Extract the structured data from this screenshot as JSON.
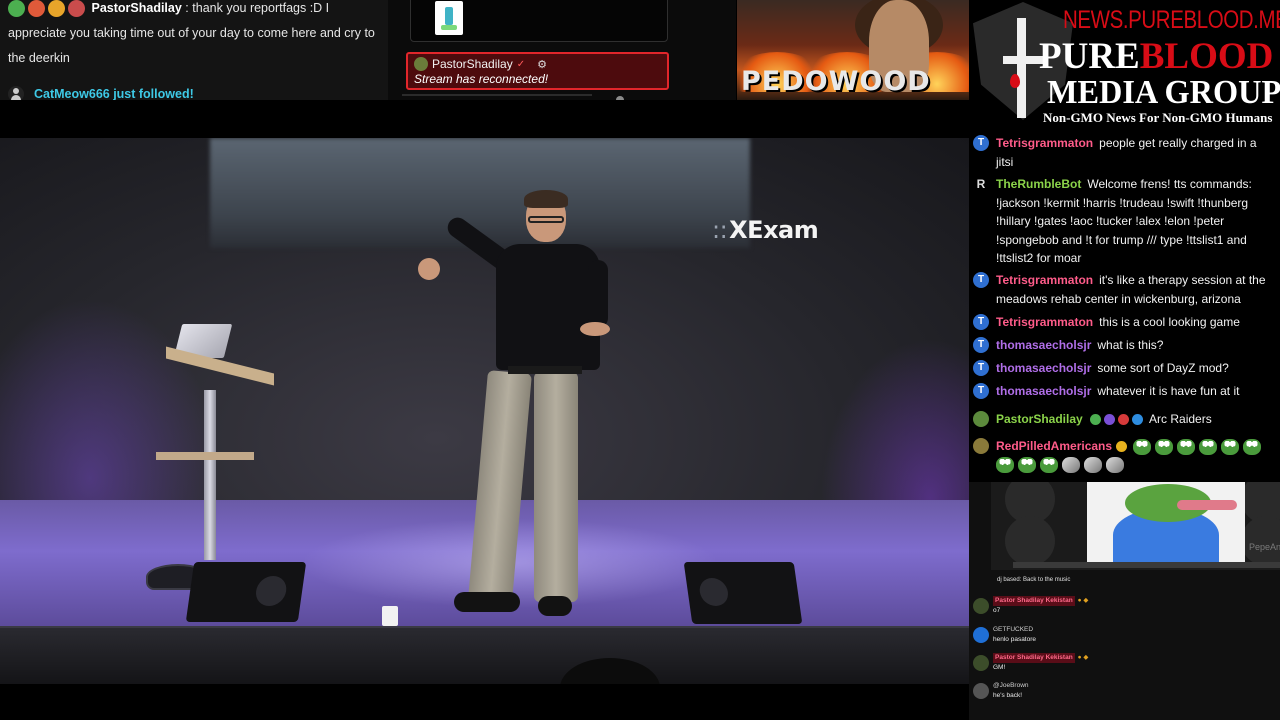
{
  "top_chat": {
    "message": {
      "username": "PastorShadilay",
      "separator": ":",
      "text": "thank you reportfags :D I appreciate you taking time out of your day to come here and cry to the deerkin",
      "badge_colors": [
        "#4caf50",
        "#e05a3a",
        "#e8a52a",
        "#c94c4c"
      ]
    },
    "follow_notice": "CatMeow666 just followed!"
  },
  "alerts": {
    "reconnect": {
      "username": "PastorShadilay",
      "verified_glyph": "✓",
      "settings_icon": "gear-icon",
      "message": "Stream has reconnected!"
    }
  },
  "top_thumbnail": {
    "text": "PEDOWOOD"
  },
  "logo": {
    "url": "NEWS.PUREBLOOD.MEDIA",
    "line1_white": "PURE",
    "line1_red": "BLOOD",
    "line2": "MEDIA GROUP",
    "tagline": "Non-GMO News For Non-GMO Humans",
    "brand_red": "#d80c16"
  },
  "video": {
    "slide_dots": "::",
    "slide_text": "XExam"
  },
  "chat": {
    "messages": [
      {
        "avatar": "T",
        "username": "Tetrisgrammaton",
        "color": "#ff5c8a",
        "text": "people get really charged in a jitsi"
      },
      {
        "avatar": "R",
        "username": "TheRumbleBot",
        "color": "#8bd34a",
        "text": "Welcome frens! tts commands: !jackson !kermit !harris !trudeau !swift !thunberg !hillary !gates !aoc !tucker !alex !elon !peter !spongebob and !t for trump /// type !ttslist1 and !ttslist2 for moar"
      },
      {
        "avatar": "T",
        "username": "Tetrisgrammaton",
        "color": "#ff5c8a",
        "text": "it's like a therapy session at the meadows rehab center in wickenburg, arizona"
      },
      {
        "avatar": "T",
        "username": "Tetrisgrammaton",
        "color": "#ff5c8a",
        "text": "this is a cool looking game"
      },
      {
        "avatar": "T",
        "username": "thomasaecholsjr",
        "color": "#b06ee8",
        "text": "what is this?"
      },
      {
        "avatar": "T",
        "username": "thomasaecholsjr",
        "color": "#b06ee8",
        "text": "some sort of DayZ mod?"
      },
      {
        "avatar": "T",
        "username": "thomasaecholsjr",
        "color": "#b06ee8",
        "text": "whatever it is have fun at it"
      },
      {
        "avatar": "",
        "username": "PastorShadilay",
        "color": "#8bd34a",
        "text": "Arc Raiders",
        "badge_colors": [
          "#4caf50",
          "#7a4fd6",
          "#d63a3a",
          "#2e8de0"
        ]
      },
      {
        "avatar": "",
        "username": "RedPilledAmericans",
        "color": "#ff5c8a",
        "text": "",
        "badge_colors": [
          "#e8b21e"
        ],
        "emotes": [
          "frog",
          "frog",
          "frog",
          "frog",
          "frog",
          "frog",
          "frog",
          "frog",
          "frog",
          "ghost",
          "ghost",
          "ghost"
        ]
      }
    ]
  },
  "embed": {
    "credit": "PepeAndFre",
    "caption": "dj based: Back to the music",
    "messages": [
      {
        "username": "Pastor Shadilay Kekistan",
        "highlight": true,
        "text": "o7",
        "avatar": "pepe"
      },
      {
        "username": "GETFUCKED",
        "highlight": false,
        "text": "henlo pasatore",
        "avatar": "blue"
      },
      {
        "username": "Pastor Shadilay Kekistan",
        "highlight": true,
        "text": "GM!",
        "avatar": "pepe"
      },
      {
        "username": "@JoeBrown",
        "highlight": false,
        "text": "he's back!",
        "avatar": "gray"
      }
    ]
  }
}
